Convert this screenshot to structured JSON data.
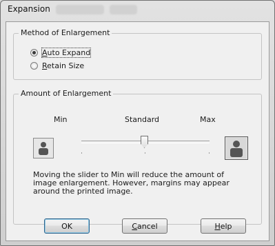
{
  "window": {
    "title": "Expansion"
  },
  "method": {
    "legend": "Method of Enlargement",
    "options": [
      {
        "label": "Auto Expand",
        "mnemonic": "A",
        "rest": "uto Expand",
        "selected": true
      },
      {
        "label": "Retain Size",
        "mnemonic": "R",
        "rest": "etain Size",
        "selected": false
      }
    ]
  },
  "amount": {
    "legend": "Amount of Enlargement",
    "min_label": "Min",
    "standard_label": "Standard",
    "max_label": "Max",
    "slider_value": "standard",
    "description": "Moving the slider to Min will reduce the amount of image enlargement. However, margins may appear around the printed image."
  },
  "buttons": {
    "ok": "OK",
    "cancel": {
      "mnemonic": "C",
      "rest": "ancel"
    },
    "help": {
      "mnemonic": "H",
      "rest": "elp"
    }
  },
  "icons": {
    "min": "person-icon",
    "max": "person-icon"
  }
}
